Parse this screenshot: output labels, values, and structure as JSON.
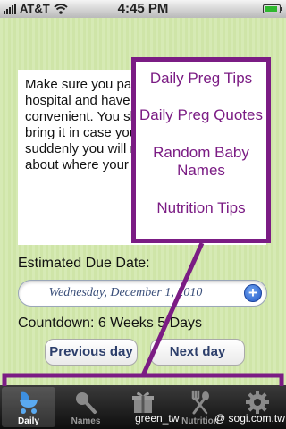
{
  "status_bar": {
    "carrier": "AT&T",
    "time": "4:45 PM",
    "battery_level": 0.85
  },
  "tip": {
    "text": "Make sure you pack a bag for the hospital and have it somewhere convenient. You should remember to bring it in case your water breaks suddenly you will not have time to think about where your bag is."
  },
  "due_date": {
    "label": "Estimated Due Date:",
    "value": "Wednesday, December 1, 2010",
    "add_symbol": "+"
  },
  "countdown": {
    "text": "Countdown: 6 Weeks 5 Days"
  },
  "nav": {
    "prev_label": "Previous day",
    "next_label": "Next day"
  },
  "menu": {
    "items": [
      {
        "label": "Daily Preg Tips"
      },
      {
        "label": "Daily Preg Quotes"
      },
      {
        "label": "Random Baby Names"
      },
      {
        "label": "Nutrition Tips"
      }
    ],
    "accent_color": "#7b1c84"
  },
  "tab_bar": {
    "tabs": [
      {
        "label": "Daily",
        "icon": "baby-stroller-icon",
        "active": true
      },
      {
        "label": "Names",
        "icon": "rattle-icon",
        "active": false
      },
      {
        "label": "",
        "icon": "gift-icon",
        "active": false
      },
      {
        "label": "Nutrition",
        "icon": "fork-spoon-icon",
        "active": false
      },
      {
        "label": "",
        "icon": "gear-icon",
        "active": false
      }
    ]
  },
  "watermark": {
    "left": "green_tw",
    "right": "@ sogi.com.tw"
  }
}
